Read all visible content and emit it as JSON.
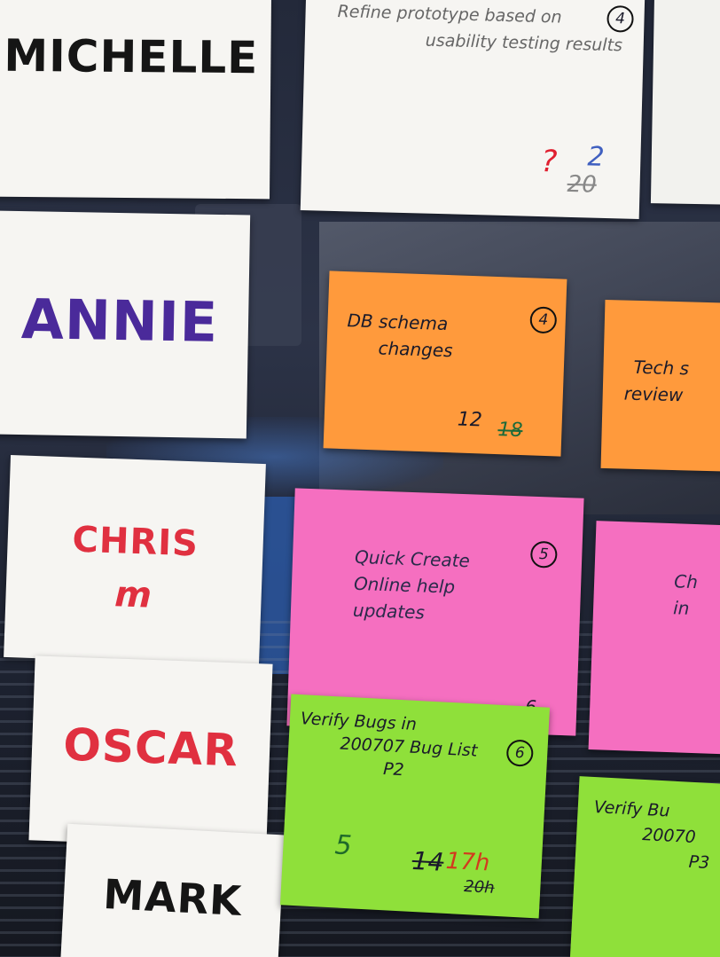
{
  "names": {
    "michelle": "MICHELLE",
    "annie": "ANNIE",
    "chris": "CHRIS",
    "chris_initial": "m",
    "oscar": "OSCAR",
    "mark": "MARK"
  },
  "notes": {
    "white": {
      "text_line1": "Refine prototype based on",
      "text_line2": "usability testing results",
      "number": "4",
      "estimate_question": "?",
      "estimate_new": "2",
      "estimate_old": "20"
    },
    "orange1": {
      "text_line1": "DB schema",
      "text_line2": "changes",
      "number": "4",
      "estimate_new": "12",
      "estimate_old": "18"
    },
    "orange2": {
      "text_line1": "Tech s",
      "text_line2": "review"
    },
    "pink1": {
      "text_line1": "Quick Create",
      "text_line2": "Online help",
      "text_line3": "updates",
      "number": "5",
      "estimate": "6"
    },
    "pink2": {
      "text_line1": "Ch",
      "text_line2": "in"
    },
    "green1": {
      "text_line1": "Verify Bugs in",
      "text_line2": "200707 Bug List",
      "text_line3": "P2",
      "number": "6",
      "estimate_green": "5",
      "estimate_old1": "14",
      "estimate_new": "17h",
      "estimate_old2": "20h"
    },
    "green2": {
      "text_line1": "Verify Bu",
      "text_line2": "20070",
      "text_line3": "P3"
    }
  },
  "colors": {
    "orange": "#ff9a3c",
    "pink": "#f56fc0",
    "green": "#8fe03a",
    "white": "#f6f5f2"
  }
}
